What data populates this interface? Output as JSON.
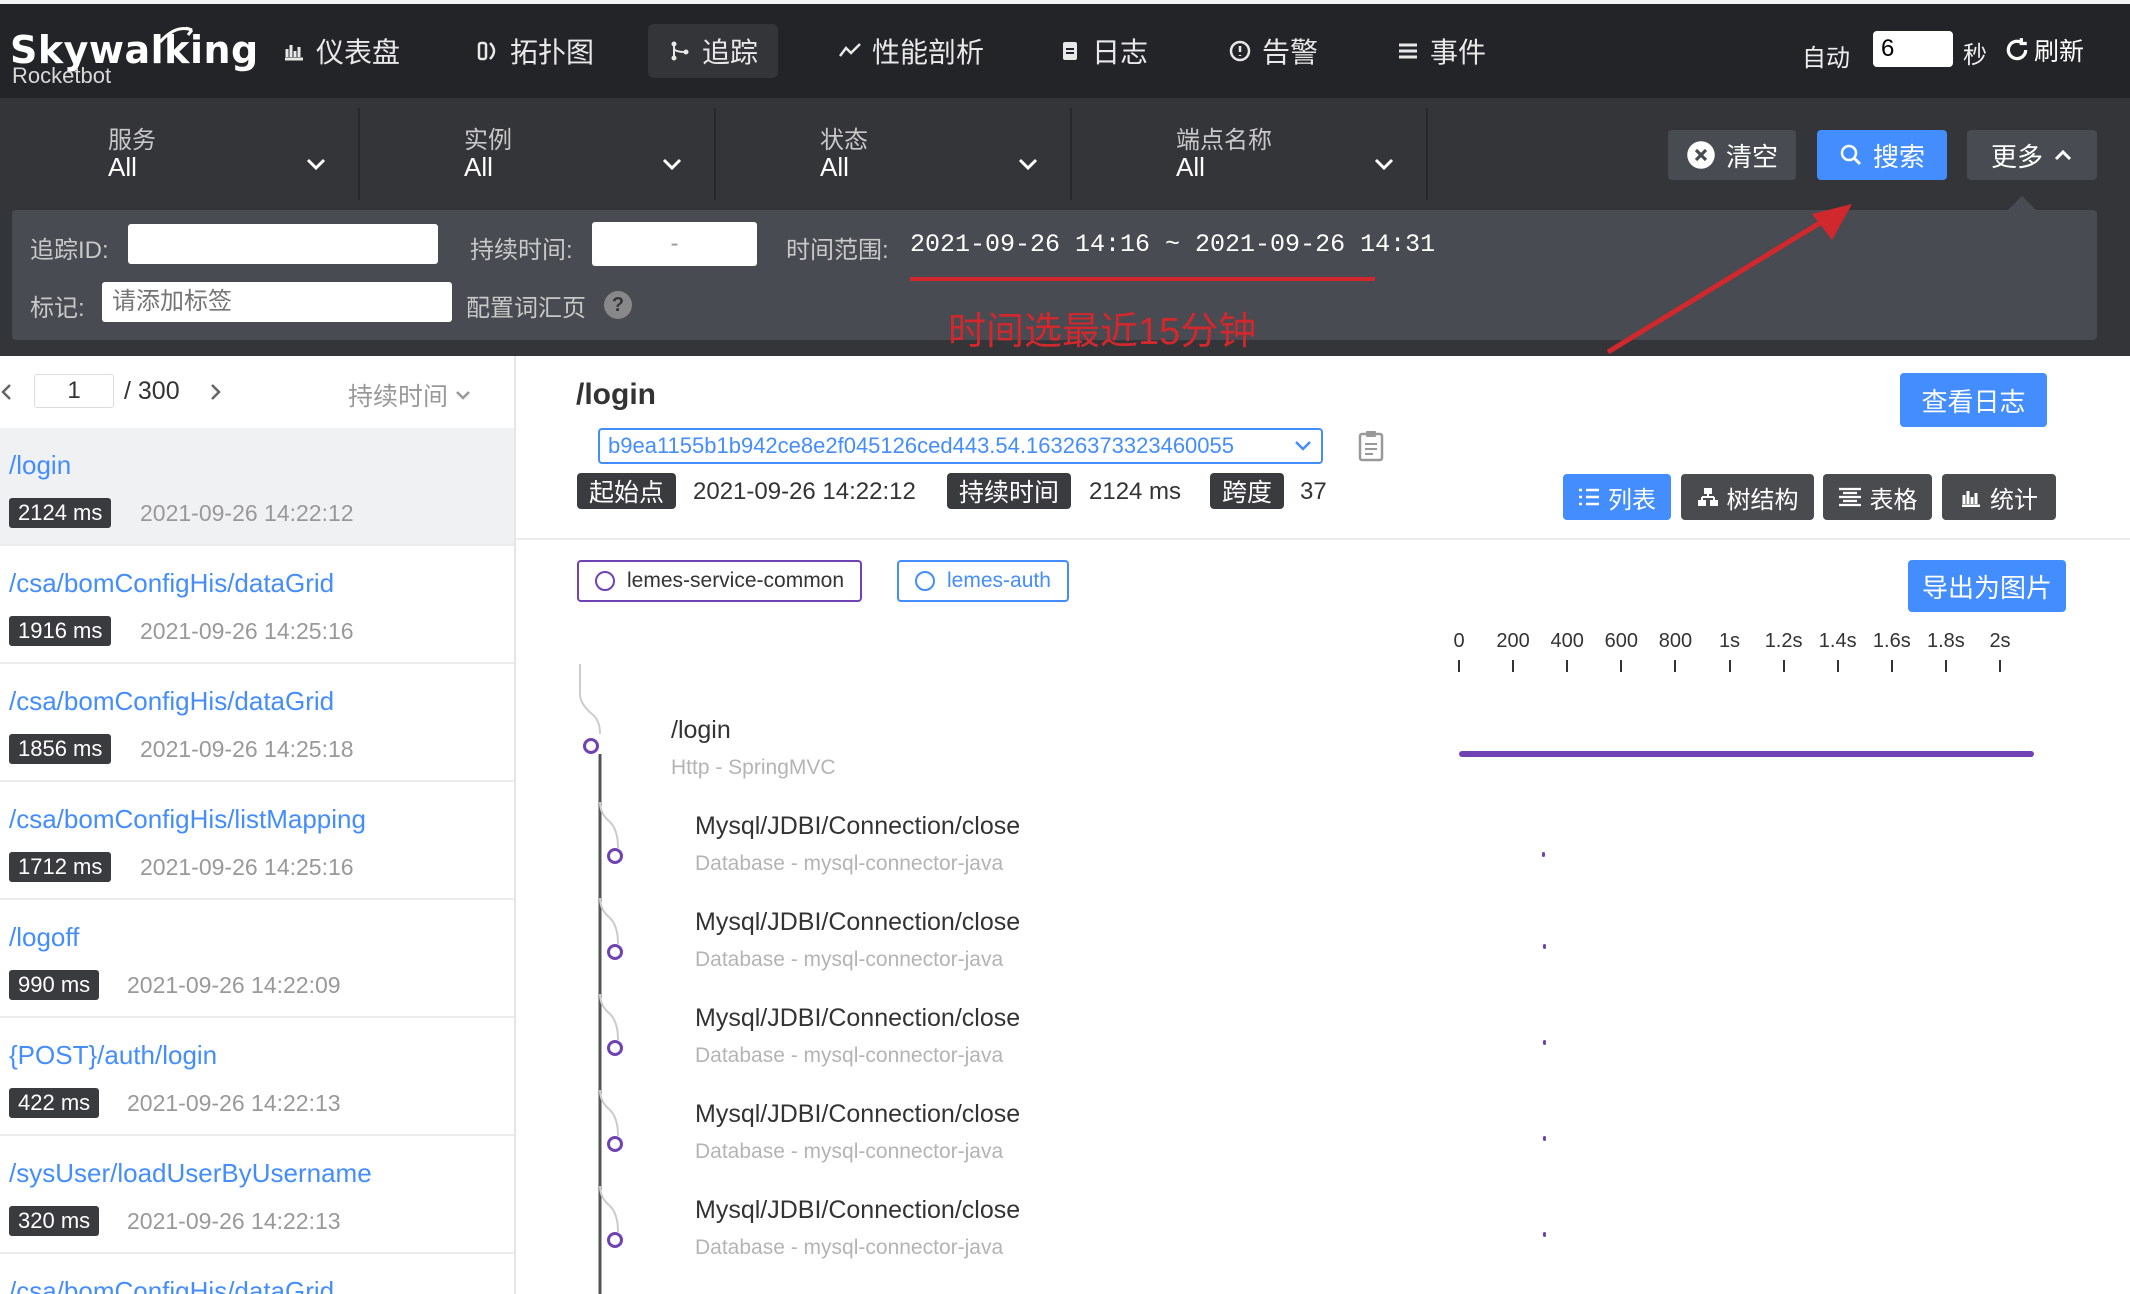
{
  "app": {
    "logo": "Skywalking",
    "logo_sub": "Rocketbot"
  },
  "nav": {
    "items": [
      {
        "label": "仪表盘",
        "icon": "dashboard-icon"
      },
      {
        "label": "拓扑图",
        "icon": "topology-icon"
      },
      {
        "label": "追踪",
        "icon": "trace-icon",
        "active": true
      },
      {
        "label": "性能剖析",
        "icon": "profile-icon"
      },
      {
        "label": "日志",
        "icon": "log-icon"
      },
      {
        "label": "告警",
        "icon": "alarm-icon"
      },
      {
        "label": "事件",
        "icon": "event-icon"
      }
    ],
    "auto_label": "自动",
    "auto_value": "6",
    "seconds_label": "秒",
    "refresh_label": "刷新"
  },
  "filters": {
    "service": {
      "label": "服务",
      "value": "All"
    },
    "instance": {
      "label": "实例",
      "value": "All"
    },
    "status": {
      "label": "状态",
      "value": "All"
    },
    "endpoint": {
      "label": "端点名称",
      "value": "All"
    },
    "clear_label": "清空",
    "search_label": "搜索",
    "more_label": "更多"
  },
  "advanced": {
    "trace_id_label": "追踪ID:",
    "trace_id_value": "",
    "duration_label": "持续时间:",
    "duration_value": "-",
    "time_range_label": "时间范围:",
    "time_range_value": "2021-09-26 14:16 ~ 2021-09-26 14:31",
    "tags_label": "标记:",
    "tags_placeholder": "请添加标签",
    "vocab_label": "配置词汇页",
    "help": "?"
  },
  "annotation": {
    "text": "时间选最近15分钟",
    "color": "#d0282d"
  },
  "list": {
    "page": "1",
    "total": "/ 300",
    "sort_label": "持续时间",
    "items": [
      {
        "endpoint": "/login",
        "duration": "2124 ms",
        "time": "2021-09-26 14:22:12"
      },
      {
        "endpoint": "/csa/bomConfigHis/dataGrid",
        "duration": "1916 ms",
        "time": "2021-09-26 14:25:16"
      },
      {
        "endpoint": "/csa/bomConfigHis/dataGrid",
        "duration": "1856 ms",
        "time": "2021-09-26 14:25:18"
      },
      {
        "endpoint": "/csa/bomConfigHis/listMapping",
        "duration": "1712 ms",
        "time": "2021-09-26 14:25:16"
      },
      {
        "endpoint": "/logoff",
        "duration": "990 ms",
        "time": "2021-09-26 14:22:09"
      },
      {
        "endpoint": "{POST}/auth/login",
        "duration": "422 ms",
        "time": "2021-09-26 14:22:13"
      },
      {
        "endpoint": "/sysUser/loadUserByUsername",
        "duration": "320 ms",
        "time": "2021-09-26 14:22:13"
      },
      {
        "endpoint": "/csa/bomConfigHis/dataGrid",
        "duration": "",
        "time": ""
      }
    ]
  },
  "detail": {
    "title": "/login",
    "view_log_label": "查看日志",
    "trace_id": "b9ea1155b1b942ce8e2f045126ced443.54.16326373323460055",
    "start_label": "起始点",
    "start_value": "2021-09-26 14:22:12",
    "duration_label": "持续时间",
    "duration_value": "2124 ms",
    "spans_label": "跨度",
    "spans_value": "37",
    "views": [
      {
        "label": "列表",
        "icon": "list-icon",
        "active": true
      },
      {
        "label": "树结构",
        "icon": "tree-icon"
      },
      {
        "label": "表格",
        "icon": "table-icon"
      },
      {
        "label": "统计",
        "icon": "stats-icon"
      }
    ],
    "services": [
      {
        "name": "lemes-service-common",
        "color": "#6f43b4"
      },
      {
        "name": "lemes-auth",
        "color": "#448dfe"
      }
    ],
    "export_label": "导出为图片"
  },
  "chart_data": {
    "type": "gantt",
    "x_ticks": [
      "0",
      "200",
      "400",
      "600",
      "800",
      "1s",
      "1.2s",
      "1.4s",
      "1.6s",
      "1.8s",
      "2s"
    ],
    "x_unit": "ms",
    "xlim": [
      0,
      2124
    ],
    "spans": [
      {
        "name": "/login",
        "sub": "Http - SpringMVC",
        "start": 0,
        "end": 2124,
        "level": 0
      },
      {
        "name": "Mysql/JDBI/Connection/close",
        "sub": "Database - mysql-connector-java",
        "start": 308,
        "end": 312,
        "level": 1
      },
      {
        "name": "Mysql/JDBI/Connection/close",
        "sub": "Database - mysql-connector-java",
        "start": 312,
        "end": 314,
        "level": 1
      },
      {
        "name": "Mysql/JDBI/Connection/close",
        "sub": "Database - mysql-connector-java",
        "start": 312,
        "end": 314,
        "level": 1
      },
      {
        "name": "Mysql/JDBI/Connection/close",
        "sub": "Database - mysql-connector-java",
        "start": 312,
        "end": 314,
        "level": 1
      },
      {
        "name": "Mysql/JDBI/Connection/close",
        "sub": "Database - mysql-connector-java",
        "start": 312,
        "end": 314,
        "level": 1
      }
    ]
  }
}
